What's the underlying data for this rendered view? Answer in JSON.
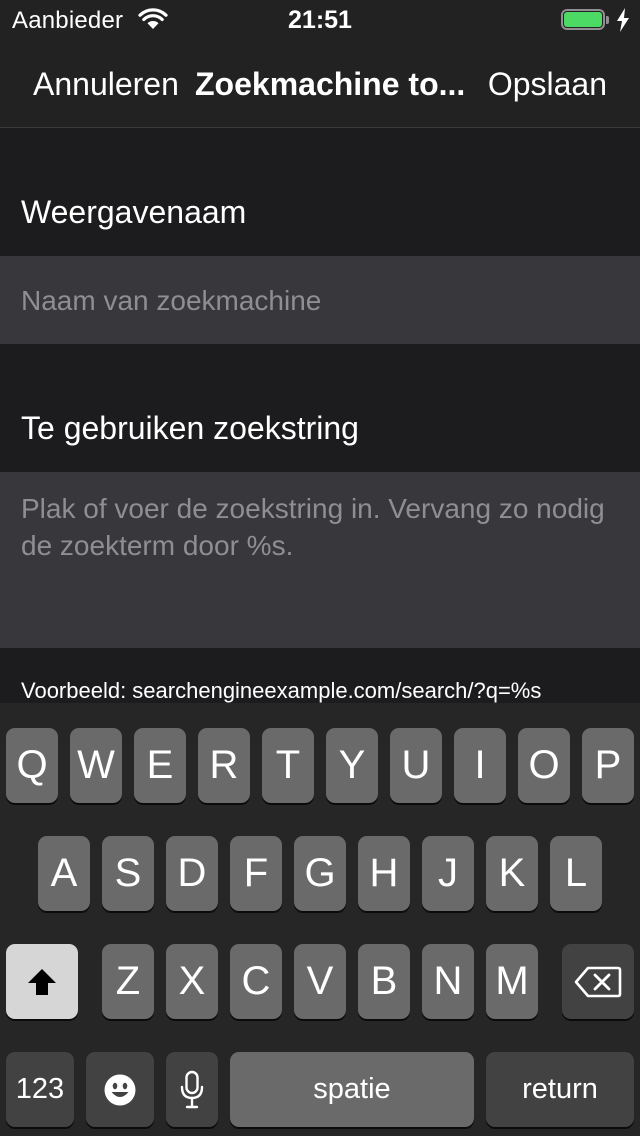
{
  "status_bar": {
    "carrier": "Aanbieder",
    "time": "21:51",
    "wifi_icon": "wifi-icon",
    "battery_icon": "battery-charging-icon",
    "battery_level": 1.0,
    "battery_color": "#4cd964"
  },
  "nav": {
    "cancel_label": "Annuleren",
    "title": "Zoekmachine to...",
    "save_label": "Opslaan"
  },
  "form": {
    "name_label": "Weergavenaam",
    "name_placeholder": "Naam van zoekmachine",
    "search_label": "Te gebruiken zoekstring",
    "search_placeholder": "Plak of voer de zoekstring in. Vervang zo nodig de zoekterm door %s.",
    "example": "Voorbeeld: searchengineexample.com/search/?q=%s"
  },
  "keyboard": {
    "row1": [
      "Q",
      "W",
      "E",
      "R",
      "T",
      "Y",
      "U",
      "I",
      "O",
      "P"
    ],
    "row2": [
      "A",
      "S",
      "D",
      "F",
      "G",
      "H",
      "J",
      "K",
      "L"
    ],
    "row3": [
      "Z",
      "X",
      "C",
      "V",
      "B",
      "N",
      "M"
    ],
    "numbers_label": "123",
    "space_label": "spatie",
    "return_label": "return",
    "shift_icon": "shift-icon",
    "backspace_icon": "backspace-icon",
    "emoji_icon": "emoji-icon",
    "mic_icon": "microphone-icon"
  }
}
